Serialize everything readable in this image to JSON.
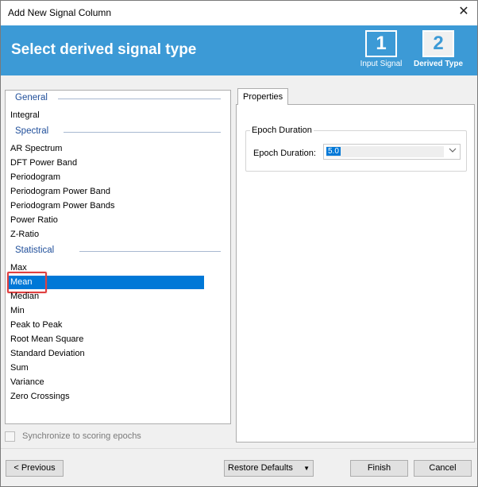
{
  "window": {
    "title": "Add New Signal Column",
    "close_glyph": "✕"
  },
  "banner": {
    "heading": "Select derived signal type",
    "steps": [
      {
        "number": "1",
        "label": "Input Signal"
      },
      {
        "number": "2",
        "label": "Derived Type"
      }
    ],
    "color": "#3c9ad6"
  },
  "signal_list": {
    "groups": [
      {
        "header": "General",
        "items": [
          "Integral"
        ]
      },
      {
        "header": "Spectral",
        "items": [
          "AR Spectrum",
          "DFT Power Band",
          "Periodogram",
          "Periodogram Power Band",
          "Periodogram Power Bands",
          "Power Ratio",
          "Z-Ratio"
        ]
      },
      {
        "header": "Statistical",
        "items": [
          "Max",
          "Mean",
          "Median",
          "Min",
          "Peak to Peak",
          "Root Mean Square",
          "Standard Deviation",
          "Sum",
          "Variance",
          "Zero Crossings"
        ]
      }
    ],
    "selected": "Mean",
    "selection_color": "#0078d7",
    "highlight_color": "#e04040"
  },
  "sync_checkbox": {
    "label": "Synchronize to scoring epochs",
    "checked": false
  },
  "properties": {
    "tab_label": "Properties",
    "group_title": "Epoch Duration",
    "field_label": "Epoch Duration:",
    "field_value": "5.0",
    "dropdown_icon": "chevron-down-icon"
  },
  "buttons": {
    "previous": "< Previous",
    "restore": "Restore Defaults",
    "restore_arrow": "▼",
    "finish": "Finish",
    "cancel": "Cancel"
  }
}
